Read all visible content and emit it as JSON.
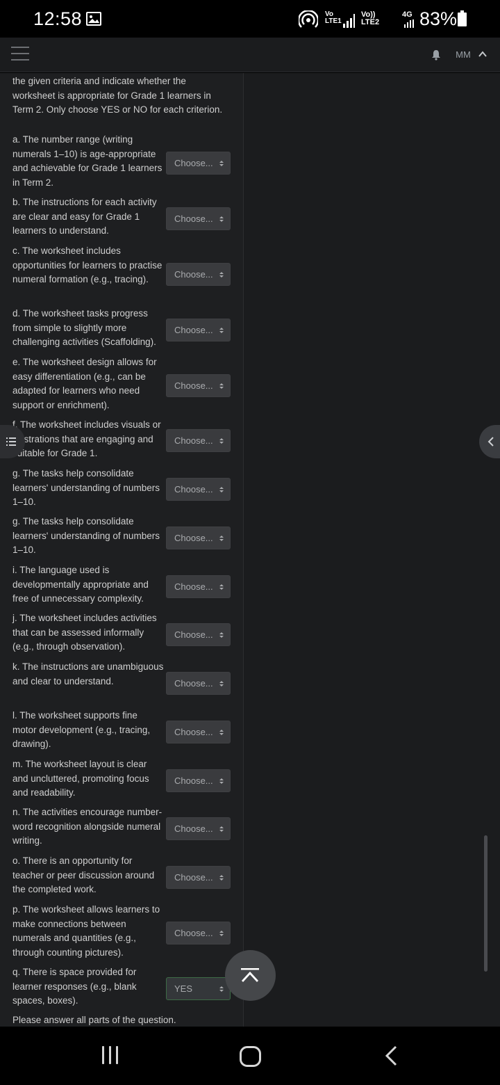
{
  "status_bar": {
    "time": "12:58",
    "sim1_label": "Vo\nLTE1",
    "sim2_label": "Vo))\nLTE2",
    "network_type": "4G",
    "battery_percent": "83%",
    "icons": [
      "gallery-icon",
      "hotspot-icon",
      "signal-icon",
      "battery-icon"
    ]
  },
  "app_bar": {
    "menu_icon": "hamburger-icon",
    "notification_icon": "bell-icon",
    "user_initials": "MM",
    "collapse_icon": "chevron-up-icon"
  },
  "question": {
    "intro": "the given criteria and indicate whether the worksheet is appropriate for Grade 1 learners in Term 2. Only choose YES or NO for each criterion.",
    "criteria": [
      {
        "text": "a. The number range (writing numerals 1–10) is age-appropriate and achievable for Grade 1 learners in Term 2.",
        "selected": "Choose..."
      },
      {
        "text": "b. The instructions for each activity are clear and easy for Grade 1 learners to understand.",
        "selected": "Choose..."
      },
      {
        "text": "c. The worksheet includes opportunities for learners to practise numeral formation (e.g., tracing).",
        "selected": "Choose..."
      },
      {
        "text": "d. The worksheet tasks progress from simple to slightly more challenging activities (Scaffolding).",
        "selected": "Choose..."
      },
      {
        "text": "e. The worksheet design allows for easy differentiation (e.g., can be adapted for learners who need support or enrichment).",
        "selected": "Choose..."
      },
      {
        "text": "f. The worksheet includes visuals or illustrations that are engaging and suitable for Grade 1.",
        "selected": "Choose..."
      },
      {
        "text": "g. The tasks help consolidate learners' understanding of numbers 1–10.",
        "selected": "Choose..."
      },
      {
        "text": "g. The tasks help consolidate learners' understanding of numbers 1–10.",
        "selected": "Choose..."
      },
      {
        "text": "i. The language used is developmentally appropriate and free of unnecessary complexity.",
        "selected": "Choose..."
      },
      {
        "text": "j. The worksheet includes activities that can be assessed informally (e.g., through observation).",
        "selected": "Choose..."
      },
      {
        "text": "k. The instructions are unambiguous and clear to understand.",
        "selected": "Choose..."
      },
      {
        "text": "l. The worksheet supports fine motor development (e.g., tracing, drawing).",
        "selected": "Choose..."
      },
      {
        "text": "m. The worksheet layout is clear and uncluttered, promoting focus and readability.",
        "selected": "Choose..."
      },
      {
        "text": "n. The activities encourage number-word recognition alongside numeral writing.",
        "selected": "Choose..."
      },
      {
        "text": "o. There is an opportunity for teacher or peer discussion around the completed work.",
        "selected": "Choose..."
      },
      {
        "text": "p. The worksheet allows learners to make connections between numerals and quantities (e.g., through counting pictures).",
        "selected": "Choose..."
      },
      {
        "text": "q. There is space provided for learner responses (e.g., blank spaces, boxes).",
        "selected": "YES"
      }
    ],
    "footer_note": "Please answer all parts of the question."
  },
  "floating": {
    "toc_icon": "list-icon",
    "drawer_icon": "chevron-left-icon",
    "back_to_top_icon": "arrow-up-icon"
  },
  "nav_bar": {
    "icons": [
      "recent-apps-icon",
      "home-icon",
      "back-icon"
    ]
  }
}
